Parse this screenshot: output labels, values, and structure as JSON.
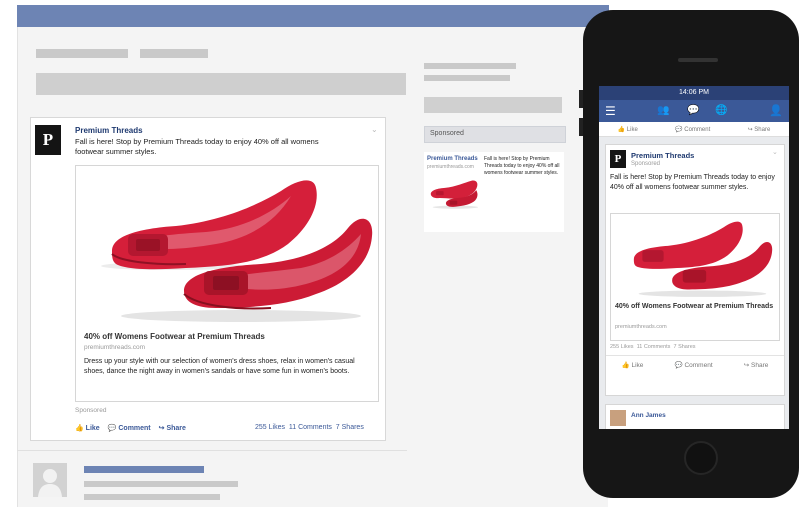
{
  "desktop_ad": {
    "page_name": "Premium Threads",
    "logo_letter": "P",
    "post_text": "Fall is here! Stop by Premium Threads today to enjoy 40% off all womens footwear summer styles.",
    "link_title": "40% off Womens Footwear at Premium Threads",
    "link_domain": "premiumthreads.com",
    "link_description": "Dress up your style with our selection of women's dress shoes, relax in women's casual shoes, dance the night away in women's sandals or have some fun in women's boots.",
    "sponsored": "Sponsored",
    "actions": [
      "Like",
      "Comment",
      "Share"
    ],
    "stats": "255 Likes  11 Comments  7 Shares"
  },
  "right_column": {
    "sponsored_header": "Sponsored",
    "ad_name": "Premium Threads",
    "ad_domain": "premiumthreads.com",
    "ad_text": "Fall is here! Stop by Premium Threads today to enjoy 40% off all womens footwear summer styles."
  },
  "phone": {
    "time": "14:06 PM",
    "top_actions": [
      "Like",
      "Comment",
      "Share"
    ],
    "page_name": "Premium Threads",
    "sponsored": "Sponsored",
    "logo_letter": "P",
    "post_text": "Fall is here! Stop by Premium Threads today to enjoy 40% off all womens footwear summer styles.",
    "link_title": "40% off Womens Footwear at Premium Threads",
    "link_domain": "premiumthreads.com",
    "stats": "255 Likes  11 Comments  7 Shares",
    "actions": [
      "Like",
      "Comment",
      "Share"
    ],
    "next_user": "Ann James"
  },
  "colors": {
    "fb_blue": "#3b5998",
    "top_bar": "#6d84b4",
    "shoe_red": "#d3203a"
  }
}
